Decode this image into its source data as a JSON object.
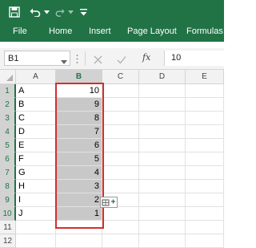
{
  "qat": {
    "icons": [
      "save-icon",
      "undo-icon",
      "redo-icon",
      "chevron-down-icon"
    ],
    "colors": {
      "brand": "#217346"
    }
  },
  "ribbon": {
    "tabs": [
      {
        "label": "File"
      },
      {
        "label": "Home"
      },
      {
        "label": "Insert"
      },
      {
        "label": "Page Layout"
      },
      {
        "label": "Formulas"
      }
    ]
  },
  "formula_bar": {
    "name_box": "B1",
    "fx_label": "fx",
    "value": "10"
  },
  "grid": {
    "columns": [
      "A",
      "B",
      "C",
      "D",
      "E"
    ],
    "selected_column": "B",
    "rows": [
      "1",
      "2",
      "3",
      "4",
      "5",
      "6",
      "7",
      "8",
      "9",
      "10",
      "11",
      "12"
    ],
    "selected_rows": [
      "1",
      "2",
      "3",
      "4",
      "5",
      "6",
      "7",
      "8",
      "9",
      "10"
    ],
    "column_a": [
      "A",
      "B",
      "C",
      "D",
      "E",
      "F",
      "G",
      "H",
      "I",
      "J",
      "",
      ""
    ],
    "column_b": [
      "10",
      "9",
      "8",
      "7",
      "6",
      "5",
      "4",
      "3",
      "2",
      "1",
      "",
      ""
    ],
    "selection_outline_color": "#d32f2f",
    "selection_fill_color": "#c8c8c8"
  },
  "quick_analysis": {
    "icon": "quick-analysis-icon"
  }
}
